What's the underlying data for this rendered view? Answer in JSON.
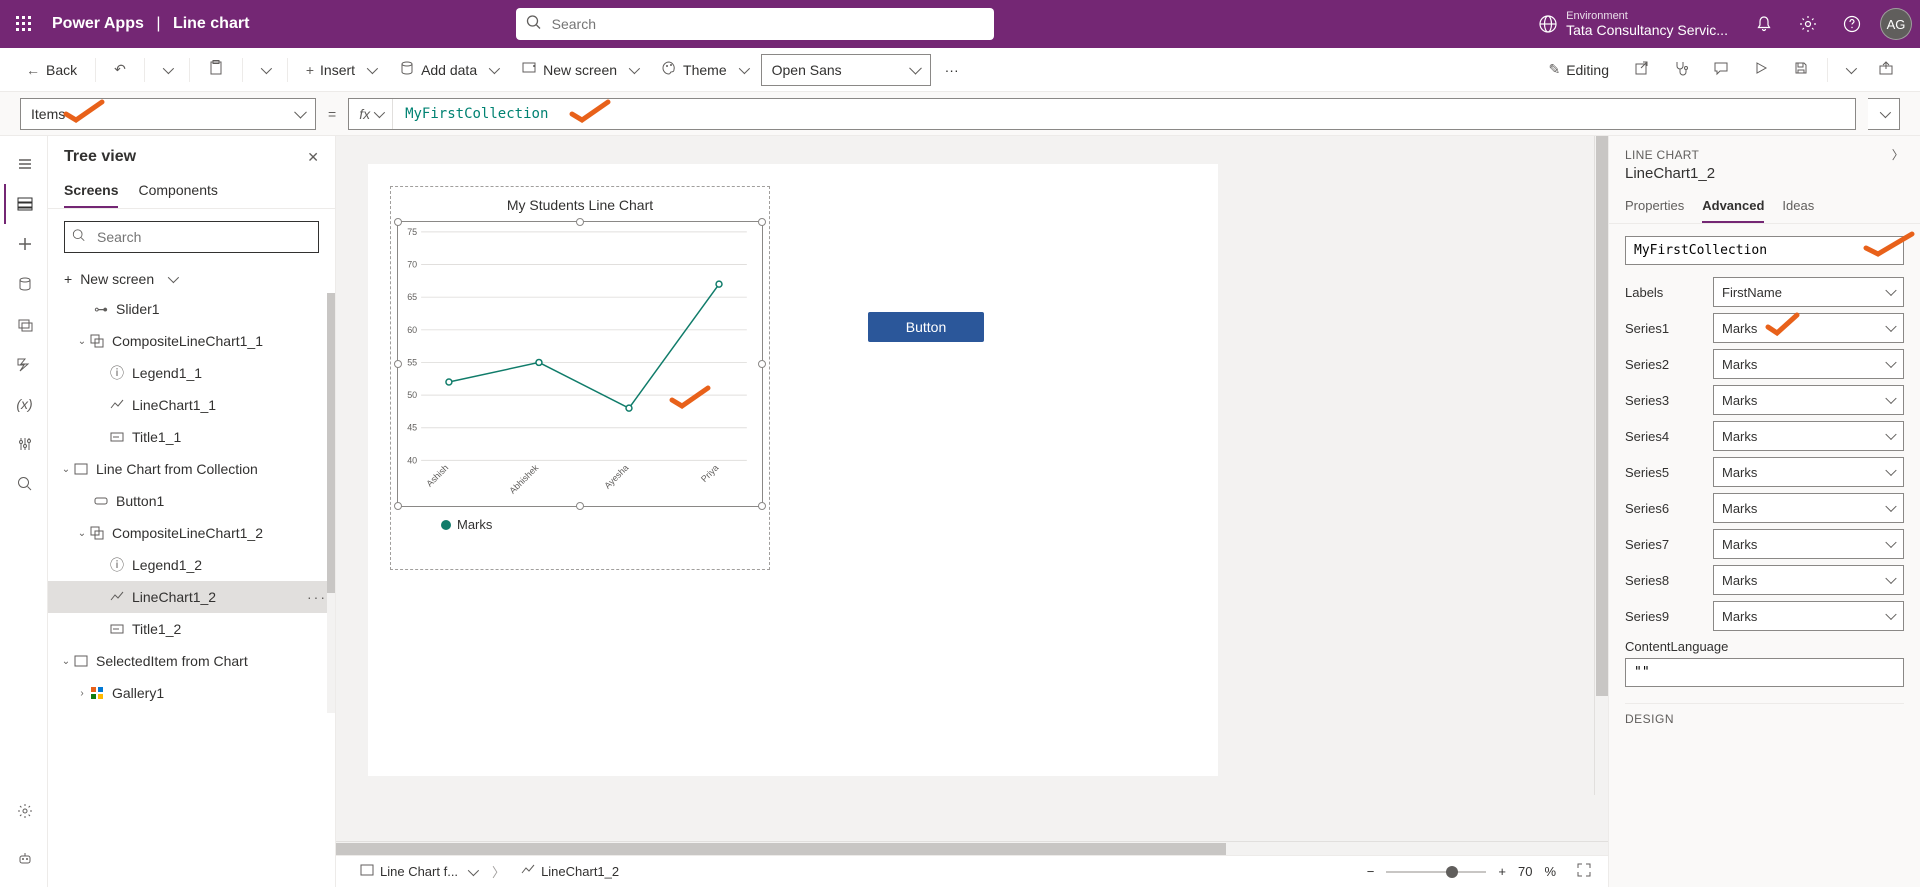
{
  "header": {
    "appName": "Power Apps",
    "pageName": "Line chart",
    "searchPlaceholder": "Search",
    "envLabel": "Environment",
    "envName": "Tata Consultancy Servic...",
    "avatar": "AG"
  },
  "cmdbar": {
    "back": "Back",
    "insert": "Insert",
    "addData": "Add data",
    "newScreen": "New screen",
    "theme": "Theme",
    "font": "Open Sans",
    "overflow": "···",
    "editing": "Editing"
  },
  "formula": {
    "property": "Items",
    "fx": "fx",
    "value": "MyFirstCollection"
  },
  "tree": {
    "title": "Tree view",
    "tabScreens": "Screens",
    "tabComponents": "Components",
    "searchPlaceholder": "Search",
    "newScreen": "New screen",
    "nodes": {
      "slider": "Slider1",
      "comp1": "CompositeLineChart1_1",
      "legend1": "Legend1_1",
      "line1": "LineChart1_1",
      "title1": "Title1_1",
      "screenColl": "Line Chart from Collection",
      "button1": "Button1",
      "comp2": "CompositeLineChart1_2",
      "legend2": "Legend1_2",
      "line2": "LineChart1_2",
      "title2": "Title1_2",
      "screenSel": "SelectedItem from Chart",
      "gallery": "Gallery1"
    }
  },
  "canvas": {
    "chartTitle": "My Students Line Chart",
    "legendSeries": "Marks",
    "buttonText": "Button",
    "breadcrumbScreen": "Line Chart f...",
    "breadcrumbControl": "LineChart1_2",
    "zoomValue": "70",
    "zoomUnit": "%"
  },
  "chart_data": {
    "type": "line",
    "title": "My Students Line Chart",
    "xlabel": "",
    "ylabel": "",
    "ylim": [
      40,
      75
    ],
    "yticks": [
      40,
      45,
      50,
      55,
      60,
      65,
      70,
      75
    ],
    "categories": [
      "Ashish",
      "Abhishek",
      "Ayesha",
      "Priya"
    ],
    "series": [
      {
        "name": "Marks",
        "values": [
          52,
          55,
          48,
          67
        ]
      }
    ]
  },
  "props": {
    "typeLabel": "LINE CHART",
    "name": "LineChart1_2",
    "tabProperties": "Properties",
    "tabAdvanced": "Advanced",
    "tabIdeas": "Ideas",
    "dataSource": "MyFirstCollection",
    "labels": {
      "label": "Labels",
      "value": "FirstName"
    },
    "series1": {
      "label": "Series1",
      "value": "Marks"
    },
    "series2": {
      "label": "Series2",
      "value": "Marks"
    },
    "series3": {
      "label": "Series3",
      "value": "Marks"
    },
    "series4": {
      "label": "Series4",
      "value": "Marks"
    },
    "series5": {
      "label": "Series5",
      "value": "Marks"
    },
    "series6": {
      "label": "Series6",
      "value": "Marks"
    },
    "series7": {
      "label": "Series7",
      "value": "Marks"
    },
    "series8": {
      "label": "Series8",
      "value": "Marks"
    },
    "series9": {
      "label": "Series9",
      "value": "Marks"
    },
    "contentLanguageLabel": "ContentLanguage",
    "contentLanguageValue": "\"\"",
    "designLabel": "DESIGN"
  }
}
